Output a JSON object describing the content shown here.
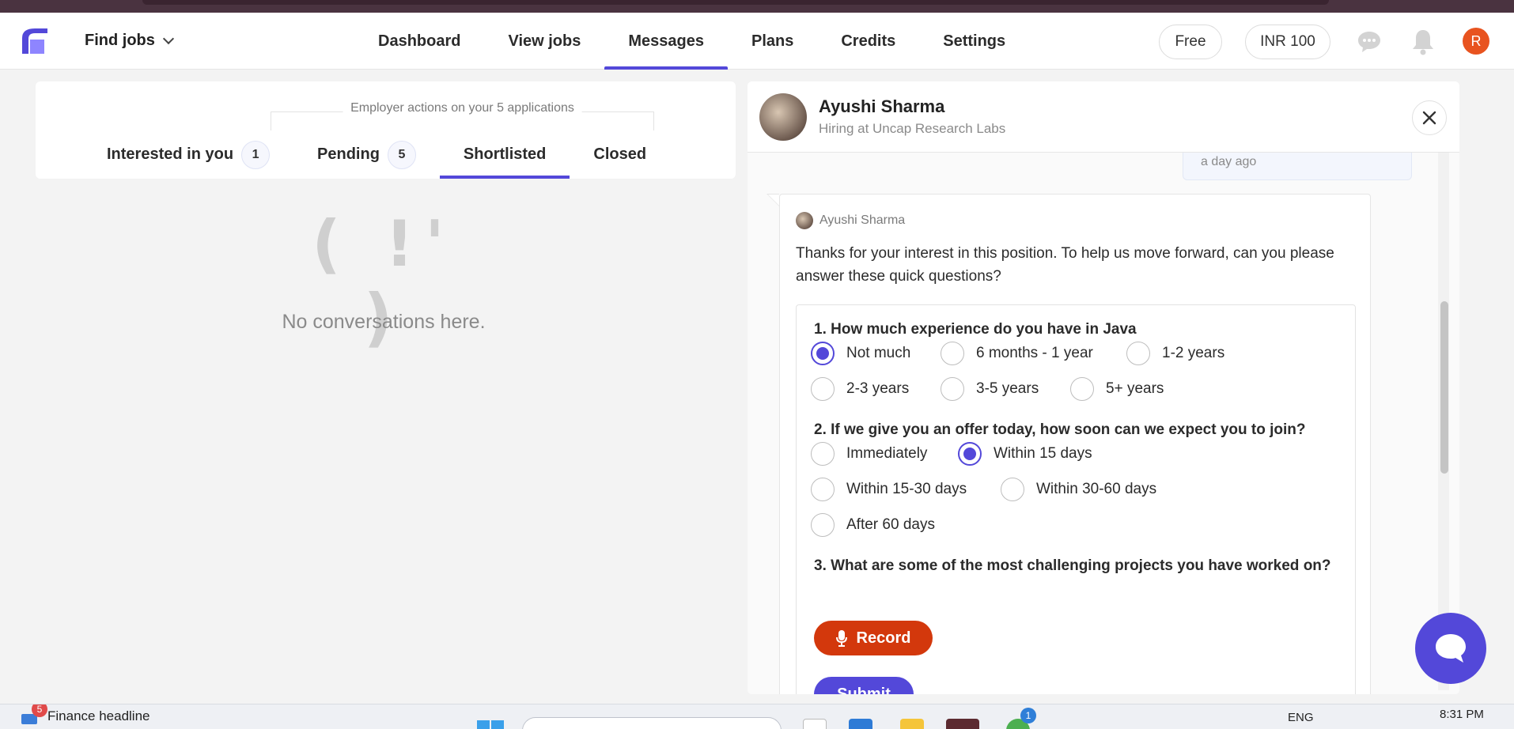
{
  "navbar": {
    "find_jobs_label": "Find jobs",
    "tabs": [
      {
        "label": "Dashboard",
        "active": false
      },
      {
        "label": "View jobs",
        "active": false
      },
      {
        "label": "Messages",
        "active": true
      },
      {
        "label": "Plans",
        "active": false
      },
      {
        "label": "Credits",
        "active": false
      },
      {
        "label": "Settings",
        "active": false
      }
    ],
    "plan_pill": "Free",
    "credits_pill": "INR 100",
    "avatar_initial": "R",
    "icons": [
      "logo-icon",
      "chevron-down-icon",
      "chat-icon",
      "bell-icon"
    ],
    "colors": {
      "accent": "#5348d9",
      "avatar_bg": "#e8531f"
    }
  },
  "applications": {
    "caption": "Employer actions on your 5 applications",
    "tabs": [
      {
        "label": "Interested in you",
        "count": "1",
        "active": false
      },
      {
        "label": "Pending",
        "count": "5",
        "active": false
      },
      {
        "label": "Shortlisted",
        "count": null,
        "active": true
      },
      {
        "label": "Closed",
        "count": null,
        "active": false
      }
    ],
    "empty_face": "( !' )",
    "empty_text": "No conversations here."
  },
  "chat": {
    "recruiter_name": "Ayushi Sharma",
    "recruiter_sub": "Hiring at Uncap Research Labs",
    "previous_timestamp": "a day ago",
    "message": {
      "sender": "Ayushi Sharma",
      "text": "Thanks for your interest in this position. To help us move forward, can you please answer these quick questions?"
    },
    "questions": [
      {
        "text": "1. How much experience do you have in Java",
        "options": [
          "Not much",
          "6 months - 1 year",
          "1-2 years",
          "2-3 years",
          "3-5 years",
          "5+ years"
        ],
        "selected": "Not much"
      },
      {
        "text": "2. If we give you an offer today, how soon can we expect you to join?",
        "options": [
          "Immediately",
          "Within 15 days",
          "Within 15-30 days",
          "Within 30-60 days",
          "After 60 days"
        ],
        "selected": "Within 15 days"
      },
      {
        "text": "3. What are some of the most challenging projects you have worked on?"
      }
    ],
    "record_label": "Record",
    "submit_label": "Submit",
    "icons": [
      "close-icon",
      "mic-icon",
      "help-chat-icon"
    ]
  },
  "taskbar": {
    "news_badge": "5",
    "news_text": "Finance headline",
    "app_badge": "1",
    "language": "ENG",
    "time": "8:31 PM"
  }
}
